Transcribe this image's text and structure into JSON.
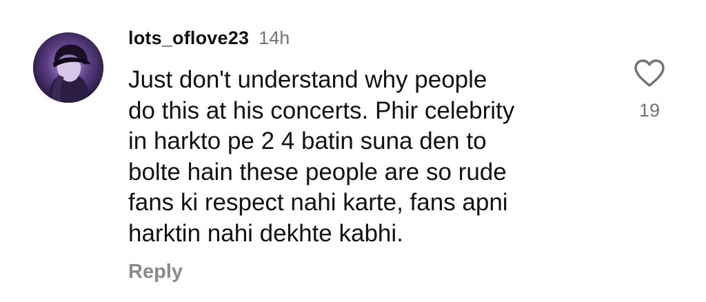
{
  "comment": {
    "username": "lots_oflove23",
    "time": "14h",
    "text": "Just don't understand why people\ndo this at his concerts. Phir celebrity\nin harkto pe 2 4 batin suna den to\nbolte hain these people are so rude\nfans ki respect nahi karte, fans apni\nharktin nahi dekhte kabhi.",
    "reply_label": "Reply",
    "like_count": "19",
    "like_icon": "heart-outline-icon"
  },
  "colors": {
    "text": "#111111",
    "muted": "#737373",
    "reply": "#8a8a8a"
  }
}
